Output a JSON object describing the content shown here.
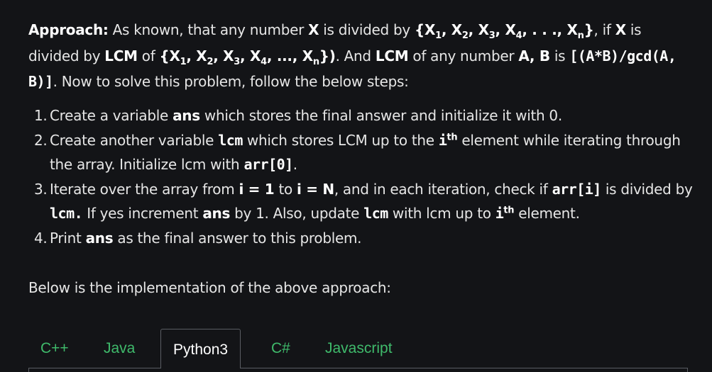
{
  "approach": {
    "label": "Approach:",
    "t1": " As known, that any number ",
    "x": "X",
    "t2": " is divided by ",
    "set_open": "{X",
    "s1": "1",
    "c1": ", X",
    "s2": "2",
    "c2": ", X",
    "s3": "3",
    "c3": ", X",
    "s4": "4",
    "c4": ", . . ., X",
    "sn": "n",
    "set_close": "}",
    "t3": ", if ",
    "x2": "X",
    "t4": " is divided by",
    "lcm": "LCM",
    "t5": " of ",
    "set2_open": "{X",
    "s2_1": "1",
    "c2_1": ", X",
    "s2_2": "2",
    "c2_2": ", X",
    "s2_3": "3",
    "c2_3": ", X",
    "s2_4": "4",
    "c2_4": ", ..., X",
    "s2_n": "n",
    "set2_close": "})",
    "t6": ". And ",
    "lcm2": "LCM",
    "t7": " of any number ",
    "ab": "A, B",
    "t8": " is ",
    "formula": "[(A*B)/gcd(A, B)]",
    "t9": ". Now to solve this problem, follow the below steps:"
  },
  "steps": [
    {
      "num": "1.",
      "a": "Create a variable ",
      "b": "ans",
      "c": " which stores the final answer and initialize it with 0."
    },
    {
      "num": "2.",
      "a": "Create another variable ",
      "b": "lcm",
      "c": " which stores LCM up to the ",
      "d": "i",
      "sup": "th",
      "e": " element while iterating through the array. Initialize lcm with ",
      "f": "arr[0]",
      "g": "."
    },
    {
      "num": "3.",
      "a": "Iterate over the array from ",
      "b": "i = 1",
      "c": " to ",
      "d": "i = N",
      "e": ", and in each iteration, check if ",
      "f": "arr[i]",
      "g": " is divided by ",
      "h": "lcm.",
      "i": " If yes increment ",
      "j": "ans",
      "k": " by 1. Also, update ",
      "l": "lcm",
      "m": " with lcm up to ",
      "n": "i",
      "sup": "th",
      "o": " element."
    },
    {
      "num": "4.",
      "a": "Print ",
      "b": "ans",
      "c": " as the final answer to this problem."
    }
  ],
  "below_text": "Below is the implementation of the above approach:",
  "tabs": [
    "C++",
    "Java",
    "Python3",
    "C#",
    "Javascript"
  ],
  "active_tab": "Python3",
  "colors": {
    "background": "#131417",
    "text": "#e6e6e6",
    "tab_green": "#3fba6b",
    "border": "#5a5d63"
  }
}
